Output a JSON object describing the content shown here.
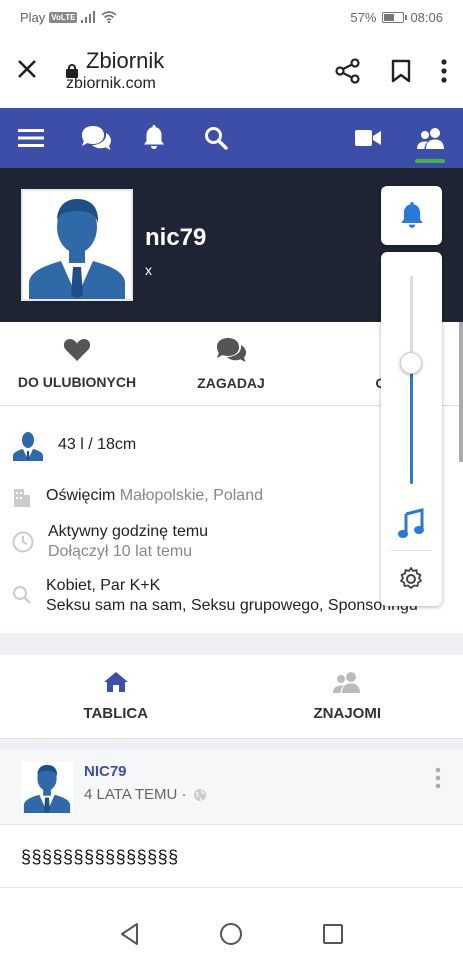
{
  "status_bar": {
    "carrier": "Play",
    "volte": "VoLTE",
    "battery_percent": "57%",
    "battery_level": 0.57,
    "time": "08:06"
  },
  "browser": {
    "title": "Zbiornik",
    "url": "zbiornik.com",
    "icons": [
      "close-icon",
      "lock-icon",
      "share-icon",
      "bookmark-icon",
      "more-vert-icon"
    ]
  },
  "nav": {
    "icons": [
      "menu-icon",
      "chat-icon",
      "bell-icon",
      "search-icon",
      "video-icon",
      "friends-icon"
    ],
    "active": "friends-icon",
    "accent_color": "#3d4ea8",
    "active_indicator_color": "#4caf50"
  },
  "profile": {
    "username": "nic79",
    "subtitle": "x"
  },
  "actions": {
    "favorite_label": "DO ULUBIONYCH",
    "talk_label": "ZAGADAJ",
    "third_label": "OP"
  },
  "info": {
    "stats": "43 l / 18cm",
    "city": "Oświęcim",
    "region": "Małopolskie, Poland",
    "active": "Aktywny godzinę temu",
    "joined": "Dołączył 10 lat temu",
    "looking_for": "Kobiet, Par K+K",
    "interests": "Seksu sam na sam, Seksu grupowego, Sponsoringu"
  },
  "tabs": {
    "wall_label": "TABLICA",
    "friends_label": "ZNAJOMI"
  },
  "post": {
    "author": "NIC79",
    "time": "4 LATA TEMU ·",
    "body": "§§§§§§§§§§§§§§§"
  },
  "volume_panel": {
    "level": 0.58,
    "accent_color": "#2979d9"
  }
}
